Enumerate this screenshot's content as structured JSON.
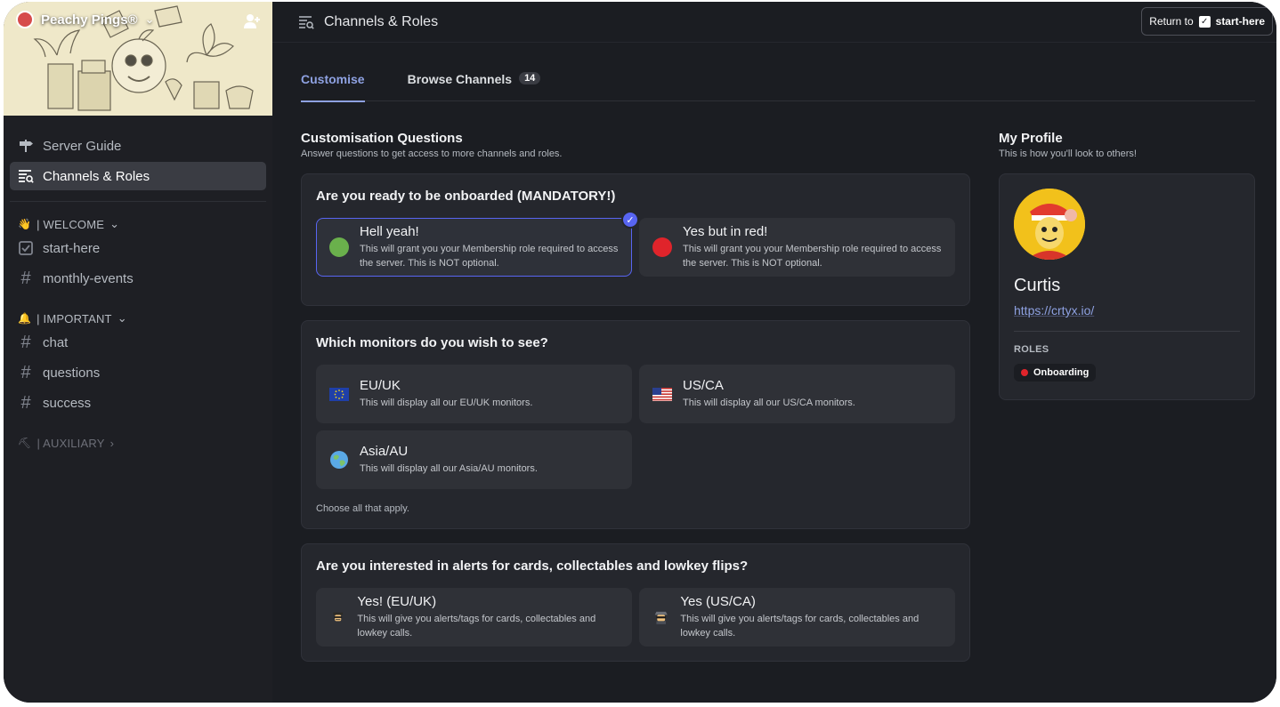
{
  "server": {
    "name": "Peachy Pings®",
    "chevron": "⌄"
  },
  "sidebar": {
    "nav": [
      {
        "label": "Server Guide",
        "icon": "signpost-icon"
      },
      {
        "label": "Channels & Roles",
        "icon": "channels-roles-icon",
        "active": true
      }
    ],
    "categories": [
      {
        "emoji": "👋",
        "label": "| WELCOME",
        "chevron": "⌄",
        "channels": [
          {
            "label": "start-here",
            "icon": "checkbox-icon"
          },
          {
            "label": "monthly-events",
            "icon": "hash-icon"
          }
        ]
      },
      {
        "emoji": "🔔",
        "label": "| IMPORTANT",
        "chevron": "⌄",
        "channels": [
          {
            "label": "chat",
            "icon": "hash-icon"
          },
          {
            "label": "questions",
            "icon": "hash-icon"
          },
          {
            "label": "success",
            "icon": "hash-icon"
          }
        ]
      },
      {
        "emoji": "⛏",
        "label": "| AUXILIARY",
        "chevron": "›",
        "channels": []
      }
    ]
  },
  "topbar": {
    "title": "Channels & Roles",
    "return_prefix": "Return to",
    "return_target": "start-here"
  },
  "tabs": [
    {
      "label": "Customise",
      "active": true
    },
    {
      "label": "Browse Channels",
      "badge": "14"
    }
  ],
  "customisation": {
    "title": "Customisation Questions",
    "subtitle": "Answer questions to get access to more channels and roles.",
    "questions": [
      {
        "title": "Are you ready to be onboarded (MANDATORY!)",
        "options": [
          {
            "label": "Hell yeah!",
            "desc": "This will grant you your Membership role required to access the server. This is NOT optional.",
            "color": "#6ab04c",
            "selected": true
          },
          {
            "label": "Yes but in red!",
            "desc": "This will grant you your Membership role required to access the server. This is NOT optional.",
            "color": "#e0242b",
            "selected": false
          }
        ]
      },
      {
        "title": "Which monitors do you wish to see?",
        "options": [
          {
            "label": "EU/UK",
            "desc": "This will display all our EU/UK monitors.",
            "icon": "eu-flag-icon"
          },
          {
            "label": "US/CA",
            "desc": "This will display all our US/CA monitors.",
            "icon": "us-flag-icon"
          },
          {
            "label": "Asia/AU",
            "desc": "This will display all our Asia/AU monitors.",
            "icon": "globe-icon"
          }
        ],
        "footer": "Choose all that apply."
      },
      {
        "title": "Are you interested in alerts for cards, collectables and lowkey flips?",
        "options": [
          {
            "label": "Yes! (EU/UK)",
            "desc": "This will give you alerts/tags for cards, collectables and lowkey calls.",
            "icon": "detective-icon"
          },
          {
            "label": "Yes (US/CA)",
            "desc": "This will give you alerts/tags for cards, collectables and lowkey calls.",
            "icon": "spy-icon"
          }
        ]
      }
    ]
  },
  "profile": {
    "title": "My Profile",
    "subtitle": "This is how you'll look to others!",
    "name": "Curtis",
    "link": "https://crtyx.io/",
    "roles_label": "ROLES",
    "role": {
      "label": "Onboarding",
      "color": "#e0242b"
    }
  },
  "colors": {
    "accent": "#5865f2",
    "tab_active": "#8ea1e1"
  }
}
